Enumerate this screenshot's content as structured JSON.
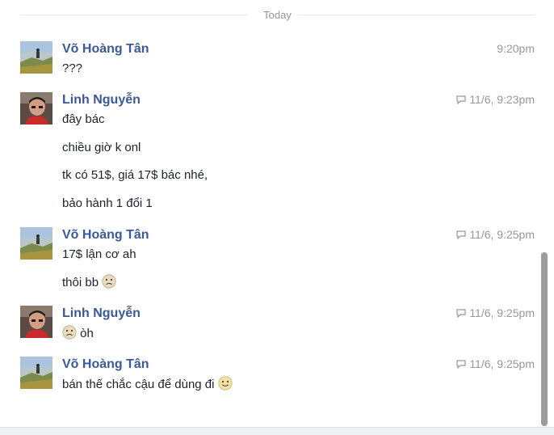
{
  "day_divider": "Today",
  "messages": [
    {
      "sender": "Võ Hoàng Tân",
      "avatar": "landscape-avatar",
      "time": "9:20pm",
      "seen": false,
      "lines": [
        "???"
      ]
    },
    {
      "sender": "Linh Nguyễn",
      "avatar": "boy-avatar",
      "time": "11/6, 9:23pm",
      "seen": true,
      "lines": [
        "đây bác",
        "chiều giờ k onl",
        "tk có 51$, giá 17$ bác nhé,",
        "bảo hành 1 đổi 1"
      ]
    },
    {
      "sender": "Võ Hoàng Tân",
      "avatar": "landscape-avatar",
      "time": "11/6, 9:25pm",
      "seen": true,
      "lines": [
        "17$ lận cơ ah",
        "thôi bb"
      ]
    },
    {
      "sender": "Linh Nguyễn",
      "avatar": "boy-avatar",
      "time": "11/6, 9:25pm",
      "seen": true,
      "lines": [
        "òh"
      ]
    },
    {
      "sender": "Võ Hoàng Tân",
      "avatar": "landscape-avatar",
      "time": "11/6, 9:25pm",
      "seen": true,
      "lines": [
        "bán thế chắc cậu để dùng đi"
      ]
    }
  ]
}
